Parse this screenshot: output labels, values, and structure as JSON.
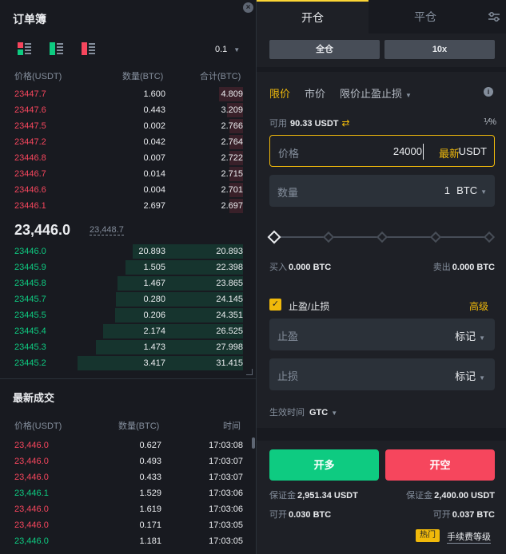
{
  "orderbook": {
    "title": "订单簿",
    "close_icon": "close-icon",
    "precision": "0.1",
    "headers": {
      "price": "价格(USDT)",
      "qty": "数量(BTC)",
      "total": "合计(BTC)"
    },
    "asks": [
      {
        "price": "23447.7",
        "qty": "1.600",
        "total": "4.809",
        "depth": 0.145
      },
      {
        "price": "23447.6",
        "qty": "0.443",
        "total": "3.209",
        "depth": 0.097
      },
      {
        "price": "23447.5",
        "qty": "0.002",
        "total": "2.766",
        "depth": 0.084
      },
      {
        "price": "23447.2",
        "qty": "0.042",
        "total": "2.764",
        "depth": 0.083
      },
      {
        "price": "23446.8",
        "qty": "0.007",
        "total": "2.722",
        "depth": 0.082
      },
      {
        "price": "23446.7",
        "qty": "0.014",
        "total": "2.715",
        "depth": 0.082
      },
      {
        "price": "23446.6",
        "qty": "0.004",
        "total": "2.701",
        "depth": 0.081
      },
      {
        "price": "23446.1",
        "qty": "2.697",
        "total": "2.697",
        "depth": 0.081
      }
    ],
    "last_price": "23,446.0",
    "mark_price": "23,448.7",
    "bids": [
      {
        "price": "23446.0",
        "qty": "20.893",
        "total": "20.893",
        "depth": 0.665
      },
      {
        "price": "23445.9",
        "qty": "1.505",
        "total": "22.398",
        "depth": 0.712
      },
      {
        "price": "23445.8",
        "qty": "1.467",
        "total": "23.865",
        "depth": 0.759
      },
      {
        "price": "23445.7",
        "qty": "0.280",
        "total": "24.145",
        "depth": 0.768
      },
      {
        "price": "23445.5",
        "qty": "0.206",
        "total": "24.351",
        "depth": 0.774
      },
      {
        "price": "23445.4",
        "qty": "2.174",
        "total": "26.525",
        "depth": 0.844
      },
      {
        "price": "23445.3",
        "qty": "1.473",
        "total": "27.998",
        "depth": 0.89
      },
      {
        "price": "23445.2",
        "qty": "3.417",
        "total": "31.415",
        "depth": 1.0
      }
    ]
  },
  "trades": {
    "title": "最新成交",
    "headers": {
      "price": "价格(USDT)",
      "qty": "数量(BTC)",
      "time": "时间"
    },
    "rows": [
      {
        "price": "23,446.0",
        "qty": "0.627",
        "time": "17:03:08",
        "side": "sell"
      },
      {
        "price": "23,446.0",
        "qty": "0.493",
        "time": "17:03:07",
        "side": "sell"
      },
      {
        "price": "23,446.0",
        "qty": "0.433",
        "time": "17:03:07",
        "side": "sell"
      },
      {
        "price": "23,446.1",
        "qty": "1.529",
        "time": "17:03:06",
        "side": "buy"
      },
      {
        "price": "23,446.0",
        "qty": "1.619",
        "time": "17:03:06",
        "side": "sell"
      },
      {
        "price": "23,446.0",
        "qty": "0.171",
        "time": "17:03:05",
        "side": "sell"
      },
      {
        "price": "23,446.0",
        "qty": "1.181",
        "time": "17:03:05",
        "side": "buy"
      }
    ]
  },
  "order_panel": {
    "tabs": {
      "open": "开仓",
      "close": "平仓",
      "settings_icon": "sliders-icon"
    },
    "margin_mode": "全仓",
    "leverage": "10x",
    "order_types": {
      "limit": "限价",
      "market": "市价",
      "stop_limit": "限价止盈止损"
    },
    "available_label": "可用",
    "available_value": "90.33 USDT",
    "transfer_icon": "transfer-icon",
    "percent_icon": "percent-icon",
    "price": {
      "label": "价格",
      "value": "24000",
      "latest": "最新",
      "unit": "USDT"
    },
    "qty": {
      "label": "数量",
      "value": "1",
      "unit": "BTC"
    },
    "slider_percent": 0,
    "buy": {
      "label": "买入",
      "value": "0.000 BTC"
    },
    "sell": {
      "label": "卖出",
      "value": "0.000 BTC"
    },
    "tpsl": {
      "label": "止盈/止损",
      "checked": true,
      "advanced": "高级"
    },
    "take_profit": {
      "label": "止盈",
      "ref": "标记"
    },
    "stop_loss": {
      "label": "止损",
      "ref": "标记"
    },
    "tif": {
      "label": "生效时间",
      "value": "GTC"
    },
    "long_btn": "开多",
    "short_btn": "开空",
    "margin_long": {
      "label": "保证金",
      "value": "2,951.34 USDT"
    },
    "margin_short": {
      "label": "保证金",
      "value": "2,400.00 USDT"
    },
    "max_long": {
      "label": "可开",
      "value": "0.030 BTC"
    },
    "max_short": {
      "label": "可开",
      "value": "0.037 BTC"
    },
    "hot_badge": "热门",
    "fee_link": "手续费等级"
  },
  "colors": {
    "red": "#f6465d",
    "green": "#0ecb81",
    "accent": "#f0b90b"
  }
}
